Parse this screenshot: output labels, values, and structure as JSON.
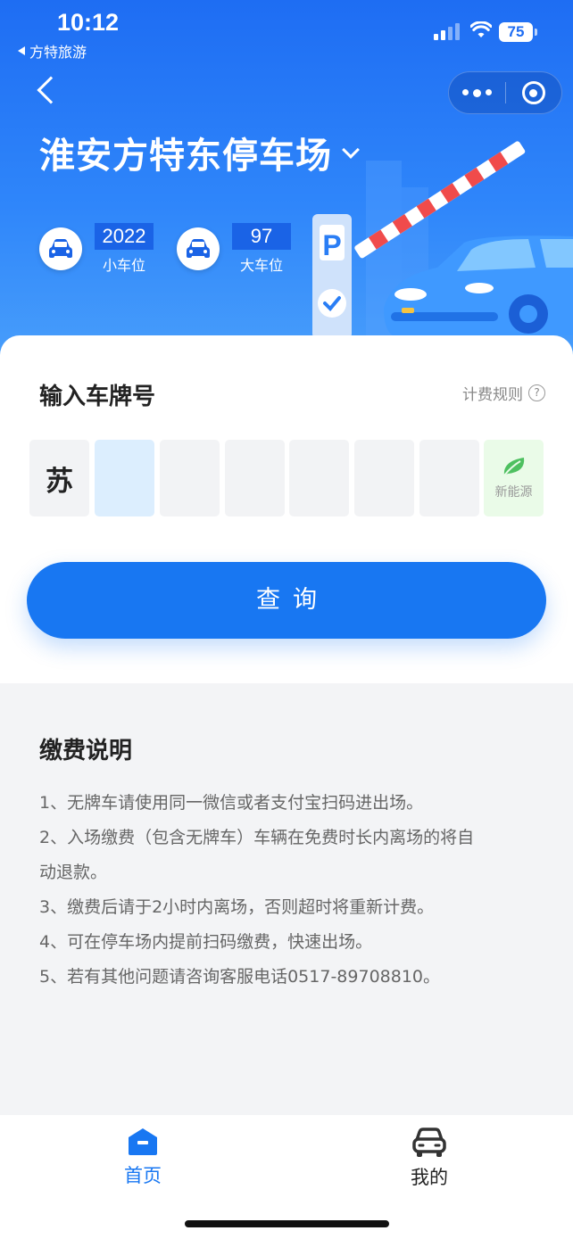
{
  "status_bar": {
    "time": "10:12",
    "back_app": "方特旅游",
    "battery": "75"
  },
  "header": {
    "lot_name": "淮安方特东停车场",
    "small_spaces": {
      "count": "2022",
      "label": "小车位"
    },
    "large_spaces": {
      "count": "97",
      "label": "大车位"
    },
    "sign_letter": "P"
  },
  "plate_input": {
    "title": "输入车牌号",
    "billing_rules": "计费规则",
    "help_symbol": "?",
    "province": "苏",
    "new_energy_label": "新能源",
    "query_button": "查询"
  },
  "payment_notes": {
    "title": "缴费说明",
    "items": [
      "1、无牌车请使用同一微信或者支付宝扫码进出场。",
      "2、入场缴费（包含无牌车）车辆在免费时长内离场的将自",
      "动退款。",
      "3、缴费后请于2小时内离场，否则超时将重新计费。",
      "4、可在停车场内提前扫码缴费，快速出场。",
      "5、若有其他问题请咨询客服电话0517-89708810。"
    ]
  },
  "tabbar": {
    "home": "首页",
    "mine": "我的"
  },
  "colors": {
    "primary": "#1877f2",
    "header": "#1e6df3",
    "ev_plate": "#eafbe8",
    "active_plate": "#dceefe"
  }
}
